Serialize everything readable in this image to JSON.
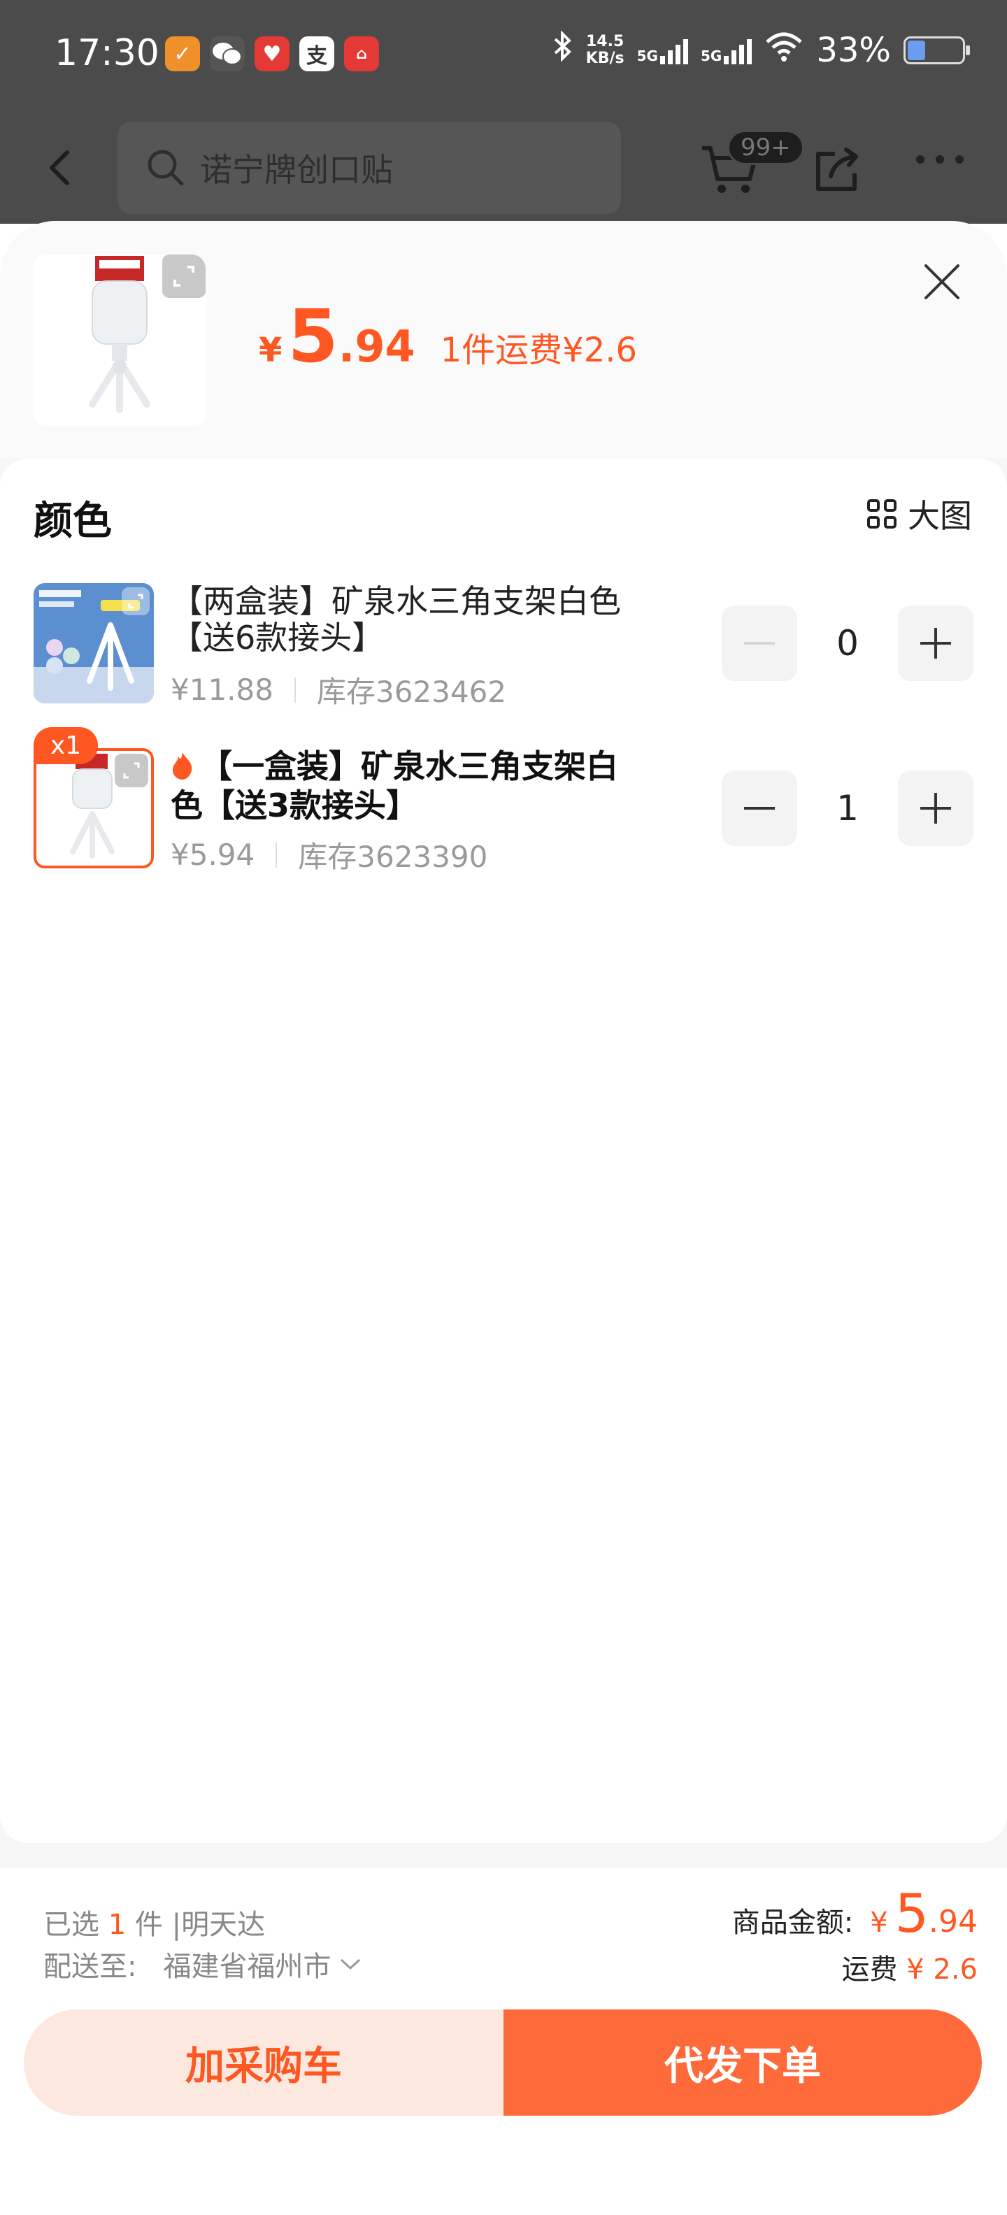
{
  "status_bar": {
    "time": "17:30",
    "net_speed_value": "14.5",
    "net_speed_unit": "KB/s",
    "signal_label_1": "5G",
    "signal_label_2": "5G",
    "battery_percent": "33%",
    "battery_level": 0.33
  },
  "top_nav": {
    "search_text": "诺宁牌创口贴",
    "cart_badge": "99+"
  },
  "sheet": {
    "price_symbol": "¥",
    "price_int": "5",
    "price_dec": ".94",
    "shipping_note": "1件运费¥2.6"
  },
  "options": {
    "section_title": "颜色",
    "big_image_label": "大图",
    "skus": [
      {
        "name": "【两盒装】矿泉水三角支架白色【送6款接头】",
        "price": "¥11.88",
        "stock": "库存3623462",
        "quantity": "0"
      },
      {
        "badge": "x1",
        "name": "【一盒装】矿泉水三角支架白色【送3款接头】",
        "price": "¥5.94",
        "stock": "库存3623390",
        "quantity": "1"
      }
    ]
  },
  "footer": {
    "selected_prefix": "已选",
    "selected_count": "1",
    "selected_suffix": "件 |明天达",
    "ship_to_label": "配送至:",
    "ship_to_address": "福建省福州市",
    "total_label": "商品金额:",
    "total_symbol": "¥",
    "total_int": "5",
    "total_dec": ".94",
    "freight_label": "运费",
    "freight_value": "¥ 2.6",
    "add_cart_label": "加采购车",
    "order_label": "代发下单"
  },
  "colors": {
    "accent": "#ff5722",
    "order_button": "#ff6a3a",
    "cart_button_bg": "#fde8df"
  }
}
